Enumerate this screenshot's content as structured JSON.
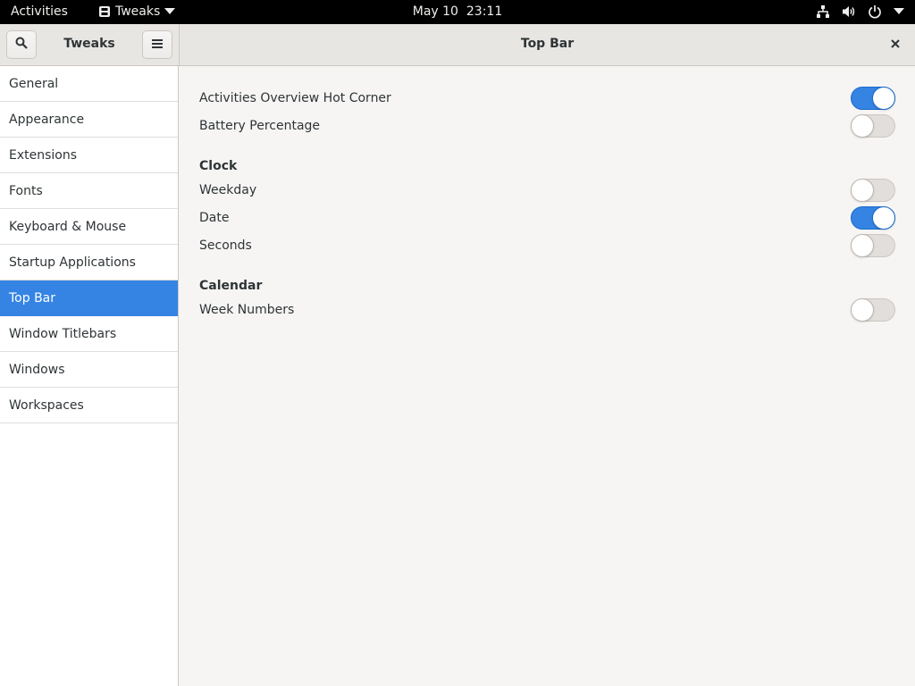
{
  "topbar": {
    "activities": "Activities",
    "app_menu": "Tweaks",
    "date": "May 10",
    "time": "23:11",
    "icons": [
      "network-wired-icon",
      "volume-icon",
      "power-icon",
      "caret-down-icon"
    ]
  },
  "window": {
    "app_title": "Tweaks",
    "page_title": "Top Bar",
    "buttons": [
      "search-icon",
      "hamburger-menu-icon",
      "close-icon"
    ]
  },
  "sidebar": {
    "items": [
      {
        "label": "General",
        "selected": false
      },
      {
        "label": "Appearance",
        "selected": false
      },
      {
        "label": "Extensions",
        "selected": false
      },
      {
        "label": "Fonts",
        "selected": false
      },
      {
        "label": "Keyboard & Mouse",
        "selected": false
      },
      {
        "label": "Startup Applications",
        "selected": false
      },
      {
        "label": "Top Bar",
        "selected": true
      },
      {
        "label": "Window Titlebars",
        "selected": false
      },
      {
        "label": "Windows",
        "selected": false
      },
      {
        "label": "Workspaces",
        "selected": false
      }
    ]
  },
  "content": {
    "general": [
      {
        "label": "Activities Overview Hot Corner",
        "on": true
      },
      {
        "label": "Battery Percentage",
        "on": false
      }
    ],
    "clock": {
      "title": "Clock",
      "items": [
        {
          "label": "Weekday",
          "on": false
        },
        {
          "label": "Date",
          "on": true
        },
        {
          "label": "Seconds",
          "on": false
        }
      ]
    },
    "calendar": {
      "title": "Calendar",
      "items": [
        {
          "label": "Week Numbers",
          "on": false
        }
      ]
    }
  },
  "colors": {
    "accent": "#3584e4",
    "topbar_bg": "#000000",
    "window_bg": "#f6f5f4",
    "sidebar_bg": "#ffffff"
  }
}
